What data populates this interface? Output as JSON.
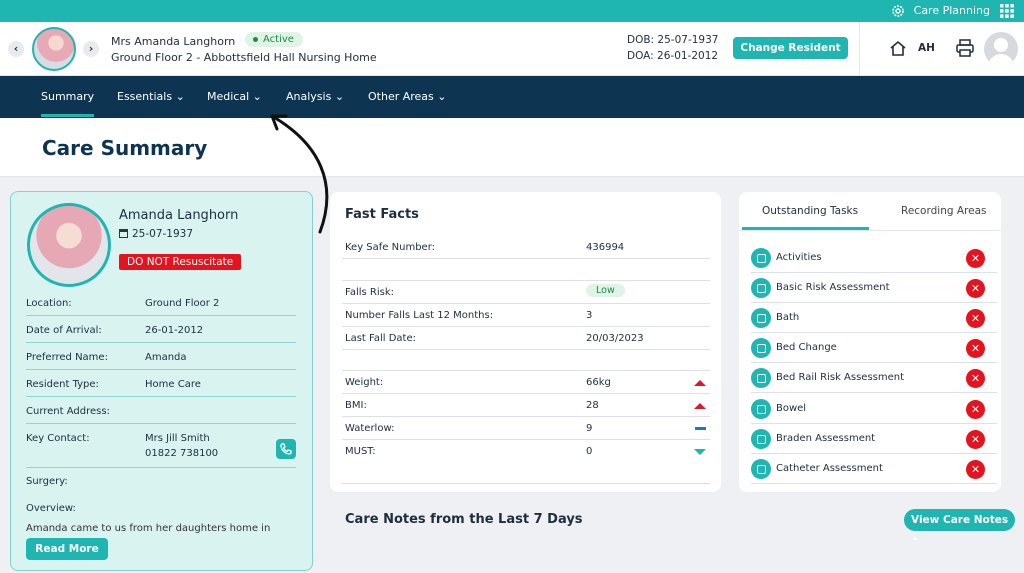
{
  "topbar": {
    "care_planning": "Care Planning",
    "settings_icon": "gear-icon",
    "apps_icon": "grid-icon"
  },
  "resident": {
    "name": "Mrs Amanda Langhorn",
    "status": "Active",
    "location": "Ground Floor 2 - Abbottsfield Hall Nursing Home",
    "dob": "DOB: 25-07-1937",
    "doa": "DOA: 26-01-2012",
    "change_label": "Change Resident",
    "prev_symbol": "‹",
    "next_symbol": "›"
  },
  "user": {
    "initials": "AH"
  },
  "nav": {
    "summary": "Summary",
    "essentials": "Essentials",
    "medical": "Medical",
    "analysis": "Analysis",
    "other": "Other Areas",
    "chevron": "⌄"
  },
  "page": {
    "title": "Care Summary"
  },
  "profile": {
    "name": "Amanda Langhorn",
    "dob": "25-07-1937",
    "dnr": "DO NOT Resuscitate",
    "rows": [
      {
        "label": "Location:",
        "value": "Ground Floor 2"
      },
      {
        "label": "Date of Arrival:",
        "value": "26-01-2012"
      },
      {
        "label": "Preferred Name:",
        "value": "Amanda"
      },
      {
        "label": "Resident Type:",
        "value": "Home Care"
      },
      {
        "label": "Current Address:",
        "value": ""
      },
      {
        "label": "Key Contact:",
        "value": "Mrs Jill Smith",
        "value2": "01822 738100"
      },
      {
        "label": "Surgery:",
        "value": ""
      }
    ],
    "overview_label": "Overview:",
    "overview_text": "Amanda came to us from her daughters home in",
    "read_more": "Read More"
  },
  "fast_facts": {
    "title": "Fast Facts",
    "key_safe": {
      "label": "Key Safe Number:",
      "value": "436994"
    },
    "falls_risk": {
      "label": "Falls Risk:",
      "value": "Low"
    },
    "falls_12": {
      "label": "Number Falls Last 12 Months:",
      "value": "3"
    },
    "last_fall": {
      "label": "Last Fall Date:",
      "value": "20/03/2023"
    },
    "weight": {
      "label": "Weight:",
      "value": "66kg",
      "trend": "up"
    },
    "bmi": {
      "label": "BMI:",
      "value": "28",
      "trend": "up"
    },
    "waterlow": {
      "label": "Waterlow:",
      "value": "9",
      "trend": "flat"
    },
    "must": {
      "label": "MUST:",
      "value": "0",
      "trend": "down"
    }
  },
  "tasks": {
    "tab_outstanding": "Outstanding Tasks",
    "tab_recording": "Recording Areas",
    "close_symbol": "✕",
    "items": [
      "Activities",
      "Basic Risk Assessment",
      "Bath",
      "Bed Change",
      "Bed Rail Risk Assessment",
      "Bowel",
      "Braden Assessment",
      "Catheter Assessment"
    ]
  },
  "care_notes": {
    "title": "Care Notes from the Last 7 Days",
    "view_label": "View Care Notes",
    "chevron_up": "⌃"
  },
  "colors": {
    "teal": "#1fb5b0",
    "navy": "#0d3552",
    "red": "#e5131d"
  }
}
